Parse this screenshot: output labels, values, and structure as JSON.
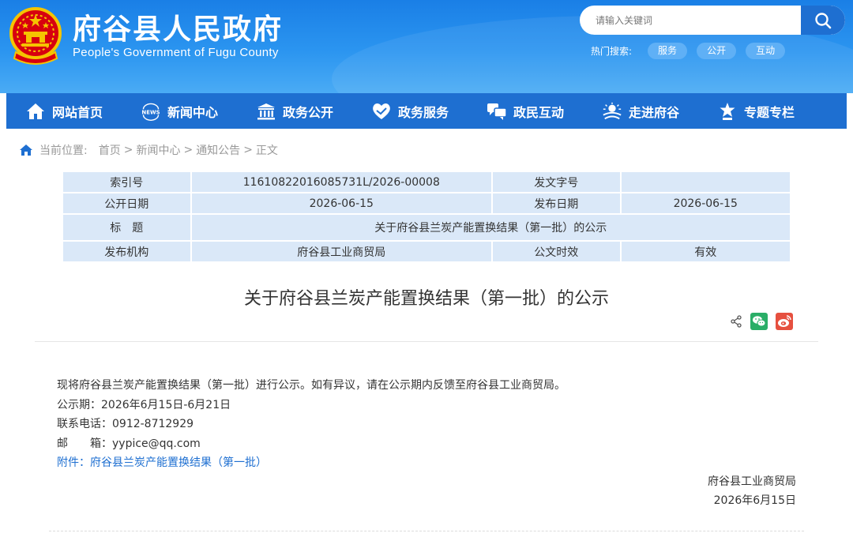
{
  "header": {
    "title": "府谷县人民政府",
    "subtitle": "People's Government of Fugu County",
    "search_placeholder": "请输入关键词",
    "hot_label": "热门搜索:",
    "hot_tags": [
      "服务",
      "公开",
      "互动"
    ]
  },
  "nav": {
    "items": [
      "网站首页",
      "新闻中心",
      "政务公开",
      "政务服务",
      "政民互动",
      "走进府谷",
      "专题专栏"
    ],
    "news_badge": "NEWS"
  },
  "breadcrumb": {
    "prefix": "当前位置:",
    "items": [
      "首页",
      "新闻中心",
      "通知公告",
      "正文"
    ],
    "separator": ">"
  },
  "meta": {
    "index_label": "索引号",
    "index_value": "11610822016085731L/2026-00008",
    "doc_no_label": "发文字号",
    "doc_no_value": "",
    "open_date_label": "公开日期",
    "open_date_value": "2026-06-15",
    "pub_date_label": "发布日期",
    "pub_date_value": "2026-06-15",
    "title_label": "标　题",
    "title_value": "关于府谷县兰炭产能置换结果（第一批）的公示",
    "org_label": "发布机构",
    "org_value": "府谷县工业商贸局",
    "validity_label": "公文时效",
    "validity_value": "有效"
  },
  "article": {
    "title": "关于府谷县兰炭产能置换结果（第一批）的公示",
    "lines": [
      "现将府谷县兰炭产能置换结果（第一批）进行公示。如有异议，请在公示期内反馈至府谷县工业商贸局。",
      "公示期：2026年6月15日-6月21日",
      "联系电话：0912-8712929",
      "邮　　箱：yypice@qq.com"
    ],
    "attachment": "附件：府谷县兰炭产能置换结果（第一批）",
    "sign_org": "府谷县工业商贸局",
    "sign_date": "2026年6月15日"
  },
  "colors": {
    "brand": "#1e6fd1",
    "table_bg": "#dae8f8",
    "wechat": "#2aae67",
    "weibo": "#e6503f"
  },
  "icons": [
    "national-emblem-icon",
    "search-icon",
    "home-icon",
    "news-icon",
    "government-building-icon",
    "heart-hand-icon",
    "chat-bubbles-icon",
    "landmark-icon",
    "star-trophy-icon",
    "share-icon",
    "wechat-icon",
    "weibo-icon"
  ]
}
